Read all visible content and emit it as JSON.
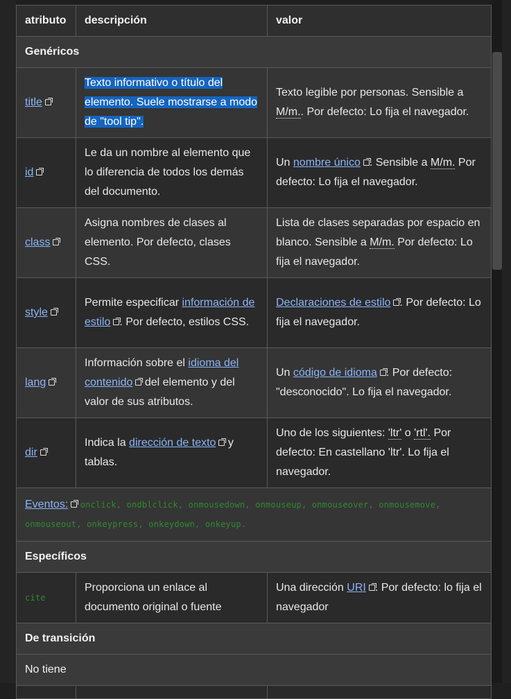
{
  "header": {
    "col1": "atributo",
    "col2": "descripción",
    "col3": "valor"
  },
  "sections": {
    "genericos": "Genéricos",
    "especificos": "Específicos",
    "transicion": "De transición",
    "no_tiene": "No tiene"
  },
  "rows": {
    "title": {
      "name": "title",
      "desc": "Texto informativo o título del elemento. Suele mostrarse a modo de \"tool tip\".",
      "val_a": "Texto legible por personas. Sensible a ",
      "val_abbr": "M/m.",
      "val_b": ". Por defecto: Lo fija el navegador."
    },
    "id": {
      "name": "id",
      "desc": "Le da un nombre al elemento que lo diferencia de todos los demás del documento.",
      "val_a": "Un ",
      "val_link": "nombre único",
      "val_b": ". Sensible a ",
      "val_abbr": "M/m.",
      "val_c": " Por defecto: Lo fija el navegador."
    },
    "class": {
      "name": "class",
      "desc": "Asigna nombres de clases al elemento. Por defecto, clases CSS.",
      "val_a": "Lista de clases separadas por espacio en blanco. Sensible a ",
      "val_abbr": "M/m.",
      "val_b": " Por defecto: Lo fija el navegador."
    },
    "style": {
      "name": "style",
      "desc_a": "Permite especificar ",
      "desc_link": "información de estilo",
      "desc_b": ". Por defecto, estilos CSS.",
      "val_link": "Declaraciones de estilo",
      "val_b": ". Por defecto: Lo fija el navegador."
    },
    "lang": {
      "name": "lang",
      "desc_a": "Información sobre el ",
      "desc_link": "idioma del contenido",
      "desc_b": " del elemento y del valor de sus atributos.",
      "val_a": "Un ",
      "val_link": "código de idioma",
      "val_b": ". Por defecto: \"desconocido\". Lo fija el navegador."
    },
    "dir": {
      "name": "dir",
      "desc_a": "Indica la ",
      "desc_link": "dirección de texto",
      "desc_b": " y tablas.",
      "val_a": "Uno de los siguientes: ",
      "val_abbr1": "'ltr'",
      "val_mid": " o ",
      "val_abbr2": "'rtl'.",
      "val_b": " Por defecto: En castellano 'ltr'. Lo fija el navegador."
    },
    "cite": {
      "name": "cite",
      "desc": "Proporciona un enlace al documento original o fuente",
      "val_a": "Una dirección ",
      "val_link": "URI",
      "val_b": ". Por defecto: lo fija el navegador"
    }
  },
  "events": {
    "label": "Eventos:",
    "list": "onclick, ondblclick, onmousedown, onmouseup, onmouseover, onmousemove, onmouseout, onkeypress, onkeydown, onkeyup."
  },
  "colors": {
    "link": "#8ab4f8",
    "selection": "#1565c0",
    "code": "#2f8a2f"
  }
}
